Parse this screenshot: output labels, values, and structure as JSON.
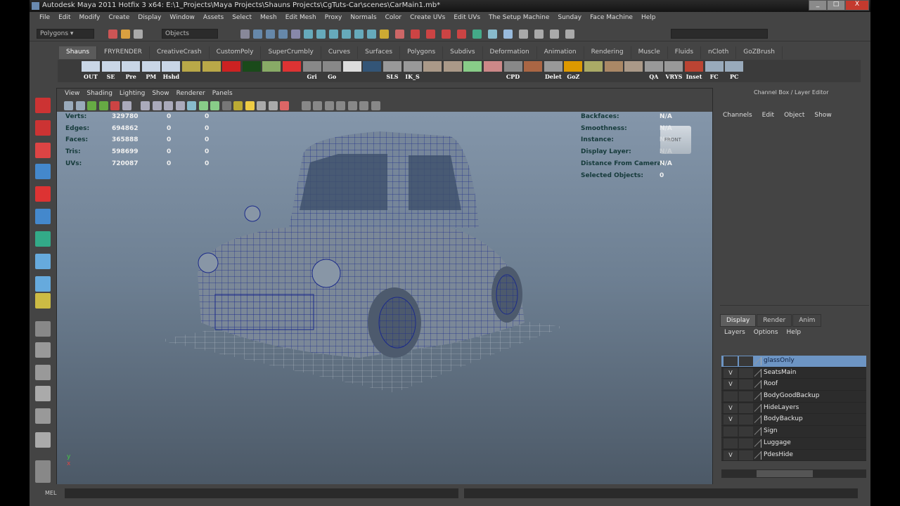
{
  "title": "Autodesk Maya 2011 Hotfix 3 x64: E:\\1_Projects\\Maya Projects\\Shauns Projects\\CgTuts-Car\\scenes\\CarMain1.mb*",
  "window_buttons": {
    "minimize": "_",
    "maximize": "□",
    "close": "X"
  },
  "menu": [
    "File",
    "Edit",
    "Modify",
    "Create",
    "Display",
    "Window",
    "Assets",
    "Select",
    "Mesh",
    "Edit Mesh",
    "Proxy",
    "Normals",
    "Color",
    "Create UVs",
    "Edit UVs",
    "The Setup Machine",
    "Sunday",
    "Face Machine",
    "Help"
  ],
  "status": {
    "mode": "Polygons",
    "selection_mode": "Objects"
  },
  "shelf_tabs": [
    "Shauns",
    "FRYRENDER",
    "CreativeCrash",
    "CustomPoly",
    "SuperCrumbly",
    "Curves",
    "Surfaces",
    "Polygons",
    "Subdivs",
    "Deformation",
    "Animation",
    "Rendering",
    "Muscle",
    "Fluids",
    "nCloth",
    "GoZBrush"
  ],
  "shelf_buttons": [
    "OUT",
    "SE",
    "Pre",
    "PM",
    "Hshd",
    "",
    "",
    "",
    "",
    "",
    "",
    "Gri",
    "Go",
    "",
    "",
    "SLS",
    "IK_S",
    "",
    "",
    "",
    "",
    "CPD",
    "",
    "Delet",
    "GoZ",
    "",
    "",
    "",
    "QA",
    "VRYS",
    "Inset",
    "FC",
    "PC"
  ],
  "viewport": {
    "menu": [
      "View",
      "Shading",
      "Lighting",
      "Show",
      "Renderer",
      "Panels"
    ],
    "stats": [
      {
        "label": "Verts:",
        "v": [
          "329780",
          "0",
          "0"
        ]
      },
      {
        "label": "Edges:",
        "v": [
          "694862",
          "0",
          "0"
        ]
      },
      {
        "label": "Faces:",
        "v": [
          "365888",
          "0",
          "0"
        ]
      },
      {
        "label": "Tris:",
        "v": [
          "598699",
          "0",
          "0"
        ]
      },
      {
        "label": "UVs:",
        "v": [
          "720087",
          "0",
          "0"
        ]
      }
    ],
    "info": [
      {
        "label": "Backfaces:",
        "v": "N/A"
      },
      {
        "label": "Smoothness:",
        "v": "N/A"
      },
      {
        "label": "Instance:",
        "v": "N/A"
      },
      {
        "label": "Display Layer:",
        "v": "N/A"
      },
      {
        "label": "Distance From Camera:",
        "v": "N/A"
      },
      {
        "label": "Selected Objects:",
        "v": "0"
      }
    ],
    "viewcube": "FRONT"
  },
  "channel_box": {
    "title": "Channel Box / Layer Editor",
    "menu": [
      "Channels",
      "Edit",
      "Object",
      "Show"
    ]
  },
  "layer_editor": {
    "tabs": [
      "Display",
      "Render",
      "Anim"
    ],
    "menu": [
      "Layers",
      "Options",
      "Help"
    ],
    "layers": [
      {
        "name": "glassOnly",
        "v": "",
        "selected": true
      },
      {
        "name": "SeatsMain",
        "v": "V"
      },
      {
        "name": "Roof",
        "v": "V"
      },
      {
        "name": "BodyGoodBackup",
        "v": ""
      },
      {
        "name": "HideLayers",
        "v": "V"
      },
      {
        "name": "BodyBackup",
        "v": "V"
      },
      {
        "name": "Sign",
        "v": ""
      },
      {
        "name": "Luggage",
        "v": ""
      },
      {
        "name": "PdesHide",
        "v": "V"
      }
    ]
  },
  "help_line": {
    "label": "MEL"
  }
}
